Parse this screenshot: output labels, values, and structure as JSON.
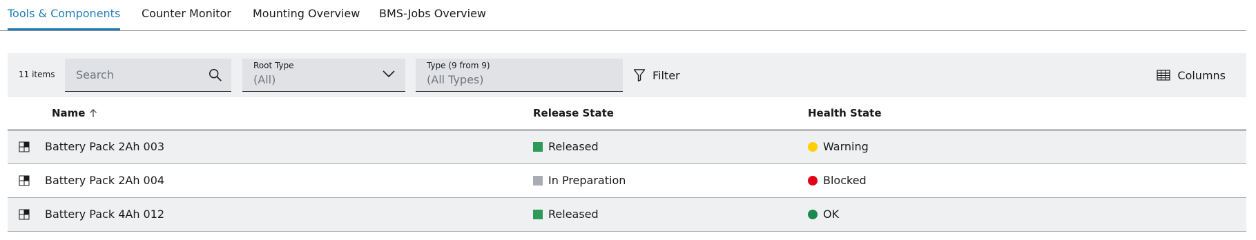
{
  "tabs": [
    {
      "label": "Tools & Components",
      "active": true
    },
    {
      "label": "Counter Monitor",
      "active": false
    },
    {
      "label": "Mounting Overview",
      "active": false
    },
    {
      "label": "BMS-Jobs Overview",
      "active": false
    }
  ],
  "toolbar": {
    "item_count": "11 items",
    "search": {
      "placeholder": "Search",
      "icon": "search-icon"
    },
    "root_type": {
      "label": "Root Type",
      "value": "(All)",
      "icon": "chevron-down-icon"
    },
    "type": {
      "label": "Type (9 from 9)",
      "value": "(All Types)"
    },
    "filter": {
      "label": "Filter",
      "icon": "filter-icon"
    },
    "columns": {
      "label": "Columns",
      "icon": "columns-icon"
    }
  },
  "table": {
    "columns": [
      {
        "label": "Name",
        "sort": "ascending"
      },
      {
        "label": "Release State"
      },
      {
        "label": "Health State"
      }
    ],
    "rows": [
      {
        "name": "Battery Pack 2Ah 003",
        "release": "Released",
        "health": "Warning"
      },
      {
        "name": "Battery Pack 2Ah 004",
        "release": "In Preparation",
        "health": "Blocked"
      },
      {
        "name": "Battery Pack 4Ah 012",
        "release": "Released",
        "health": "OK"
      }
    ]
  },
  "colors": {
    "accent": "#1f7eb8",
    "released": "#2e9a5a",
    "in_preparation": "#a9adb3",
    "warning": "#ffcf00",
    "blocked": "#e20015",
    "ok": "#1b8a4e"
  }
}
